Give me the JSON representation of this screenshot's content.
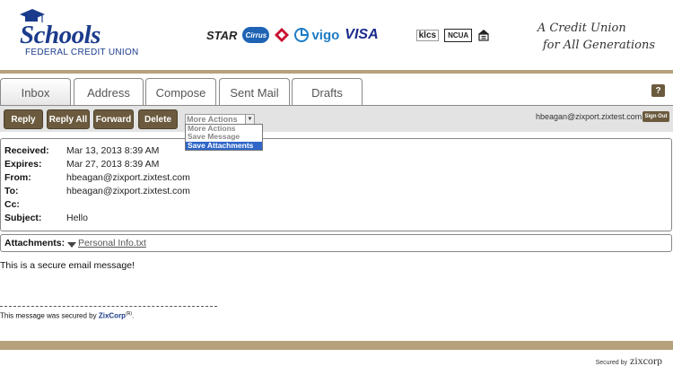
{
  "header": {
    "logo_word": "Schools",
    "logo_sub": "FEDERAL CREDIT UNION",
    "networks": {
      "star": "STAR",
      "cirrus": "Cirrus",
      "vigo": "vigo",
      "visa": "VISA",
      "klcs": "klcs",
      "ncua": "NCUA"
    },
    "tagline_line1": "A Credit Union",
    "tagline_line2": "for All Generations"
  },
  "tabs": [
    {
      "label": "Inbox",
      "active": true
    },
    {
      "label": "Address",
      "active": false
    },
    {
      "label": "Compose",
      "active": false
    },
    {
      "label": "Sent Mail",
      "active": false
    },
    {
      "label": "Drafts",
      "active": false
    }
  ],
  "help_label": "?",
  "toolbar": {
    "reply": "Reply",
    "reply_all": "Reply All",
    "forward": "Forward",
    "delete": "Delete",
    "more_actions_selected": "More Actions",
    "more_actions_options": [
      "More Actions",
      "Save Message",
      "Save Attachments"
    ],
    "highlighted_option": "Save Attachments",
    "user_email": "hbeagan@zixport.zixtest.com",
    "sign_out": "Sign Out"
  },
  "message": {
    "received_label": "Received:",
    "received": "Mar 13, 2013 8:39 AM",
    "expires_label": "Expires:",
    "expires": "Mar 27, 2013 8:39 AM",
    "from_label": "From:",
    "from": "hbeagan@zixport.zixtest.com",
    "to_label": "To:",
    "to": "hbeagan@zixport.zixtest.com",
    "cc_label": "Cc:",
    "cc": "",
    "subject_label": "Subject:",
    "subject": "Hello",
    "attachments_label": "Attachments:",
    "attachment_file": "Personal Info.txt",
    "body": "This is a secure email message!"
  },
  "footer": {
    "secured_text": "This message was secured by",
    "zixcorp": "ZixCorp",
    "reg": "(R)",
    "period": ".",
    "secured_by": "Secured by",
    "zix_logo": "zixcorp"
  },
  "colors": {
    "brand_brown": "#6b5a3e",
    "tan_rule": "#b5a27c",
    "logo_blue": "#1b3b8c",
    "highlight_blue": "#2f66c8"
  }
}
